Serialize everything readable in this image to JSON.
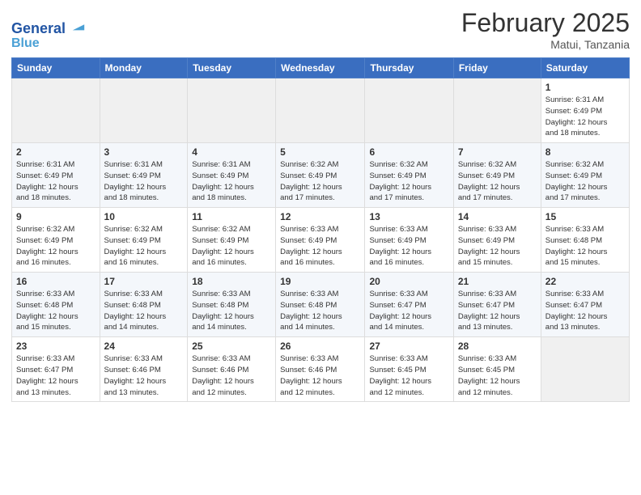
{
  "header": {
    "logo_line1": "General",
    "logo_line2": "Blue",
    "month": "February 2025",
    "location": "Matui, Tanzania"
  },
  "days_of_week": [
    "Sunday",
    "Monday",
    "Tuesday",
    "Wednesday",
    "Thursday",
    "Friday",
    "Saturday"
  ],
  "weeks": [
    [
      {
        "day": "",
        "info": ""
      },
      {
        "day": "",
        "info": ""
      },
      {
        "day": "",
        "info": ""
      },
      {
        "day": "",
        "info": ""
      },
      {
        "day": "",
        "info": ""
      },
      {
        "day": "",
        "info": ""
      },
      {
        "day": "1",
        "info": "Sunrise: 6:31 AM\nSunset: 6:49 PM\nDaylight: 12 hours\nand 18 minutes."
      }
    ],
    [
      {
        "day": "2",
        "info": "Sunrise: 6:31 AM\nSunset: 6:49 PM\nDaylight: 12 hours\nand 18 minutes."
      },
      {
        "day": "3",
        "info": "Sunrise: 6:31 AM\nSunset: 6:49 PM\nDaylight: 12 hours\nand 18 minutes."
      },
      {
        "day": "4",
        "info": "Sunrise: 6:31 AM\nSunset: 6:49 PM\nDaylight: 12 hours\nand 18 minutes."
      },
      {
        "day": "5",
        "info": "Sunrise: 6:32 AM\nSunset: 6:49 PM\nDaylight: 12 hours\nand 17 minutes."
      },
      {
        "day": "6",
        "info": "Sunrise: 6:32 AM\nSunset: 6:49 PM\nDaylight: 12 hours\nand 17 minutes."
      },
      {
        "day": "7",
        "info": "Sunrise: 6:32 AM\nSunset: 6:49 PM\nDaylight: 12 hours\nand 17 minutes."
      },
      {
        "day": "8",
        "info": "Sunrise: 6:32 AM\nSunset: 6:49 PM\nDaylight: 12 hours\nand 17 minutes."
      }
    ],
    [
      {
        "day": "9",
        "info": "Sunrise: 6:32 AM\nSunset: 6:49 PM\nDaylight: 12 hours\nand 16 minutes."
      },
      {
        "day": "10",
        "info": "Sunrise: 6:32 AM\nSunset: 6:49 PM\nDaylight: 12 hours\nand 16 minutes."
      },
      {
        "day": "11",
        "info": "Sunrise: 6:32 AM\nSunset: 6:49 PM\nDaylight: 12 hours\nand 16 minutes."
      },
      {
        "day": "12",
        "info": "Sunrise: 6:33 AM\nSunset: 6:49 PM\nDaylight: 12 hours\nand 16 minutes."
      },
      {
        "day": "13",
        "info": "Sunrise: 6:33 AM\nSunset: 6:49 PM\nDaylight: 12 hours\nand 16 minutes."
      },
      {
        "day": "14",
        "info": "Sunrise: 6:33 AM\nSunset: 6:49 PM\nDaylight: 12 hours\nand 15 minutes."
      },
      {
        "day": "15",
        "info": "Sunrise: 6:33 AM\nSunset: 6:48 PM\nDaylight: 12 hours\nand 15 minutes."
      }
    ],
    [
      {
        "day": "16",
        "info": "Sunrise: 6:33 AM\nSunset: 6:48 PM\nDaylight: 12 hours\nand 15 minutes."
      },
      {
        "day": "17",
        "info": "Sunrise: 6:33 AM\nSunset: 6:48 PM\nDaylight: 12 hours\nand 14 minutes."
      },
      {
        "day": "18",
        "info": "Sunrise: 6:33 AM\nSunset: 6:48 PM\nDaylight: 12 hours\nand 14 minutes."
      },
      {
        "day": "19",
        "info": "Sunrise: 6:33 AM\nSunset: 6:48 PM\nDaylight: 12 hours\nand 14 minutes."
      },
      {
        "day": "20",
        "info": "Sunrise: 6:33 AM\nSunset: 6:47 PM\nDaylight: 12 hours\nand 14 minutes."
      },
      {
        "day": "21",
        "info": "Sunrise: 6:33 AM\nSunset: 6:47 PM\nDaylight: 12 hours\nand 13 minutes."
      },
      {
        "day": "22",
        "info": "Sunrise: 6:33 AM\nSunset: 6:47 PM\nDaylight: 12 hours\nand 13 minutes."
      }
    ],
    [
      {
        "day": "23",
        "info": "Sunrise: 6:33 AM\nSunset: 6:47 PM\nDaylight: 12 hours\nand 13 minutes."
      },
      {
        "day": "24",
        "info": "Sunrise: 6:33 AM\nSunset: 6:46 PM\nDaylight: 12 hours\nand 13 minutes."
      },
      {
        "day": "25",
        "info": "Sunrise: 6:33 AM\nSunset: 6:46 PM\nDaylight: 12 hours\nand 12 minutes."
      },
      {
        "day": "26",
        "info": "Sunrise: 6:33 AM\nSunset: 6:46 PM\nDaylight: 12 hours\nand 12 minutes."
      },
      {
        "day": "27",
        "info": "Sunrise: 6:33 AM\nSunset: 6:45 PM\nDaylight: 12 hours\nand 12 minutes."
      },
      {
        "day": "28",
        "info": "Sunrise: 6:33 AM\nSunset: 6:45 PM\nDaylight: 12 hours\nand 12 minutes."
      },
      {
        "day": "",
        "info": ""
      }
    ]
  ]
}
